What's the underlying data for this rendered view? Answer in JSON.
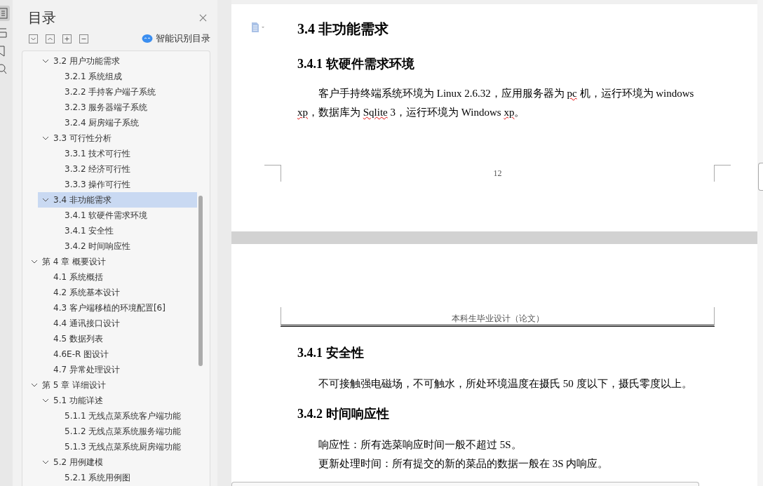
{
  "sidebar": {
    "title": "目录",
    "smart_toc_label": "智能识别目录",
    "toc": {
      "continued_children": [
        {
          "label": "3.2 用户功能需求",
          "expanded": true,
          "selected": false,
          "children": [
            {
              "label": "3.2.1 系统组成",
              "selected": false
            },
            {
              "label": "3.2.2 手持客户端子系统",
              "selected": false
            },
            {
              "label": "3.2.3 服务器端子系统",
              "selected": false
            },
            {
              "label": "3.2.4 厨房端子系统",
              "selected": false
            }
          ]
        },
        {
          "label": "3.3 可行性分析",
          "expanded": true,
          "selected": false,
          "children": [
            {
              "label": "3.3.1 技术可行性",
              "selected": false
            },
            {
              "label": "3.3.2 经济可行性",
              "selected": false
            },
            {
              "label": "3.3.3 操作可行性",
              "selected": false
            }
          ]
        },
        {
          "label": "3.4 非功能需求",
          "expanded": true,
          "selected": true,
          "children": [
            {
              "label": "3.4.1 软硬件需求环境",
              "selected": false
            },
            {
              "label": "3.4.1 安全性",
              "selected": false
            },
            {
              "label": "3.4.2 时间响应性",
              "selected": false
            }
          ]
        }
      ],
      "items": [
        {
          "label": "第 4 章  概要设计",
          "expanded": true,
          "selected": false,
          "children": [
            {
              "label": "4.1 系统概括",
              "selected": false
            },
            {
              "label": "4.2 系统基本设计",
              "selected": false
            },
            {
              "label": "4.3 客户端移植的环境配置[6]",
              "selected": false
            },
            {
              "label": "4.4 通讯接口设计",
              "selected": false
            },
            {
              "label": "4.5 数据列表",
              "selected": false
            },
            {
              "label": "4.6E-R 图设计",
              "selected": false
            },
            {
              "label": "4.7 异常处理设计",
              "selected": false
            }
          ]
        },
        {
          "label": " 第 5 章  详细设计",
          "expanded": true,
          "selected": false,
          "children": [
            {
              "label": "5.1 功能详述",
              "expanded": true,
              "selected": false,
              "children": [
                {
                  "label": "5.1.1 无线点菜系统客户端功能",
                  "selected": false
                },
                {
                  "label": "5.1.2 无线点菜系统服务端功能",
                  "selected": false
                },
                {
                  "label": "5.1.3 无线点菜系统厨房端功能",
                  "selected": false
                }
              ]
            },
            {
              "label": "5.2 用例建模",
              "expanded": true,
              "selected": false,
              "children": [
                {
                  "label": "5.2.1 系统用例图",
                  "selected": false
                }
              ]
            }
          ]
        }
      ]
    }
  },
  "pages": [
    {
      "blocks": [
        {
          "kind": "h2",
          "text": "3.4 非功能需求"
        },
        {
          "kind": "h3",
          "text": "3.4.1 软硬件需求环境"
        },
        {
          "kind": "para",
          "runs": [
            {
              "text": "客户手持终端系统环境为 Linux 2.6.32，应用服务器为 ",
              "misspelled": false
            },
            {
              "text": "pc",
              "misspelled": true
            },
            {
              "text": " 机，运行环境为 windows ",
              "misspelled": false
            },
            {
              "text": "xp",
              "misspelled": true
            },
            {
              "text": "，数据库为 ",
              "misspelled": false
            },
            {
              "text": "Sqlite",
              "misspelled": true
            },
            {
              "text": " 3，运行环境为 Windows ",
              "misspelled": false
            },
            {
              "text": "xp",
              "misspelled": true
            },
            {
              "text": "。",
              "misspelled": false
            }
          ]
        }
      ],
      "page_number": "12"
    },
    {
      "header": "本科生毕业设计（论文）",
      "blocks": [
        {
          "kind": "h3",
          "text": "3.4.1 安全性"
        },
        {
          "kind": "para",
          "runs": [
            {
              "text": "不可接触强电磁场，不可触水，所处环境温度在摄氏 50 度以下，摄氏零度以上。",
              "misspelled": false
            }
          ]
        },
        {
          "kind": "h3",
          "text": "3.4.2 时间响应性"
        },
        {
          "kind": "para",
          "runs": [
            {
              "text": "响应性：所有选菜响应时间一般不超过 5S。",
              "misspelled": false
            }
          ]
        },
        {
          "kind": "para",
          "runs": [
            {
              "text": "更新处理时间：所有提交的新的菜品的数据一般在 3S 内响应。",
              "misspelled": false
            }
          ]
        }
      ]
    }
  ]
}
